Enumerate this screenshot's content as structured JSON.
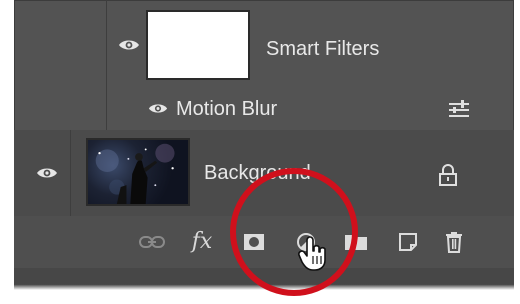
{
  "layers_panel": {
    "smart_filters_label": "Smart Filters",
    "motion_blur_label": "Motion Blur",
    "background_label": "Background"
  },
  "toolbar": {
    "buttons": [
      {
        "name": "link-layers",
        "icon": "link-icon"
      },
      {
        "name": "add-layer-style",
        "icon": "fx-icon",
        "label": "fx"
      },
      {
        "name": "add-layer-mask",
        "icon": "layer-mask-icon"
      },
      {
        "name": "new-adjustment-layer",
        "icon": "adjustment-layer-icon"
      },
      {
        "name": "new-group",
        "icon": "folder-icon"
      },
      {
        "name": "new-layer",
        "icon": "new-layer-icon"
      },
      {
        "name": "delete-layer",
        "icon": "trash-icon"
      }
    ]
  },
  "colors": {
    "panel_bg": "#535353",
    "selected_row_bg": "#4b4b4b",
    "text": "#e8e8e8",
    "highlight": "#d0101c"
  }
}
